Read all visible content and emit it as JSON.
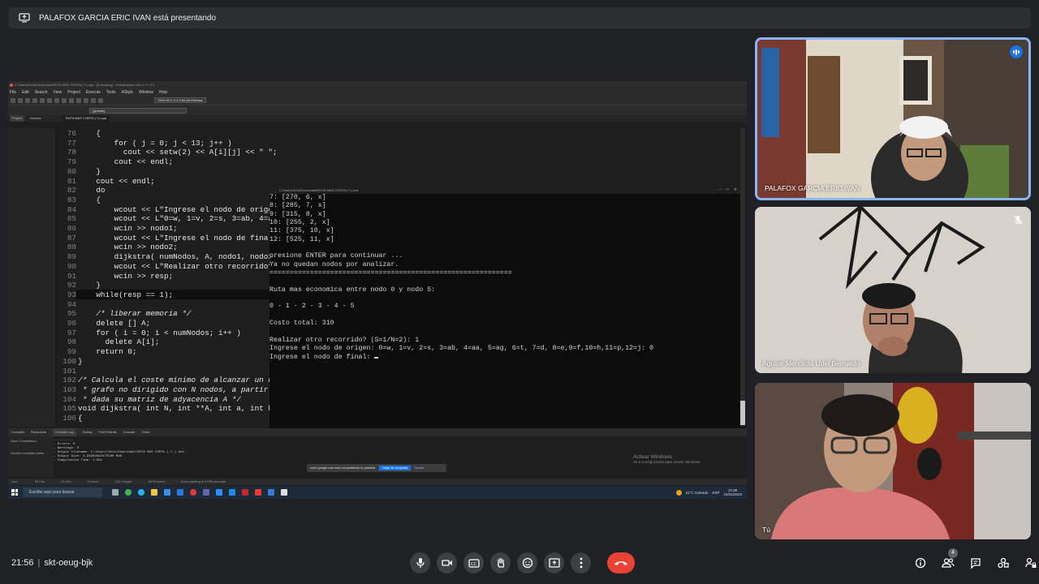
{
  "banner": {
    "text": "PALAFOX GARCIA ERIC IVAN está presentando"
  },
  "ide": {
    "title": "C:\\Users\\3c1s\\Downloads\\RUTA MAS CORTA (.Y.).cpp - [Executing] - Embarcadero Dev-C++ 6.3",
    "menu": [
      "File",
      "Edit",
      "Search",
      "View",
      "Project",
      "Execute",
      "Tools",
      "AStyle",
      "Window",
      "Help"
    ],
    "compiler": "TDM-GCC 9.2.0 64-bit Release",
    "globals": "(globals)",
    "pane_tabs": [
      "Project",
      "Classes"
    ],
    "file_tab": "RUTA MAS CORTA (.Y.).cpp",
    "code_lines": [
      {
        "n": "76",
        "t": "    {"
      },
      {
        "n": "77",
        "t": "        for ( j = 0; j < 13; j++ )"
      },
      {
        "n": "78",
        "t": "          cout << setw(2) << A[i][j] << \" \";"
      },
      {
        "n": "79",
        "t": "        cout << endl;"
      },
      {
        "n": "80",
        "t": "    }"
      },
      {
        "n": "81",
        "t": "    cout << endl;"
      },
      {
        "n": "82",
        "t": "    do"
      },
      {
        "n": "83",
        "t": "    {"
      },
      {
        "n": "84",
        "t": "        wcout << L\"Ingrese el nodo de origen"
      },
      {
        "n": "85",
        "t": "        wcout << L\"0=w, 1=v, 2=s, 3=ab, 4=aa"
      },
      {
        "n": "86",
        "t": "        wcin >> nodo1;"
      },
      {
        "n": "87",
        "t": "        wcout << L\"Ingrese el nodo de final:"
      },
      {
        "n": "88",
        "t": "        wcin >> nodo2;"
      },
      {
        "n": "89",
        "t": "        dijkstra( numNodos, A, nodo1, nodo2"
      },
      {
        "n": "90",
        "t": "        wcout << L\"Realizar otro recorrido?"
      },
      {
        "n": "91",
        "t": "        wcin >> resp;"
      },
      {
        "n": "92",
        "t": "    }"
      },
      {
        "n": "93",
        "t": "    while(resp == 1);"
      },
      {
        "n": "94",
        "t": ""
      },
      {
        "n": "95",
        "t": "    /* liberar memoria */"
      },
      {
        "n": "96",
        "t": "    delete [] A;"
      },
      {
        "n": "97",
        "t": "    for ( i = 0; i < numNodos; i++ )"
      },
      {
        "n": "98",
        "t": "      delete A[i];"
      },
      {
        "n": "99",
        "t": "    return 0;"
      },
      {
        "n": "100",
        "t": "}"
      },
      {
        "n": "101",
        "t": ""
      },
      {
        "n": "102",
        "t": "/* Calcula el coste minimo de alcanzar un nod"
      },
      {
        "n": "103",
        "t": " * grafo no dirigido con N nodos, a partir de"
      },
      {
        "n": "104",
        "t": " * dada su matriz de adyacencia A */"
      },
      {
        "n": "105",
        "t": "void dijkstra( int N, int **A, int a, int b )"
      },
      {
        "n": "106",
        "t": "{"
      }
    ],
    "bottom_tabs": [
      "Compiler",
      "Resources",
      "Compile Log",
      "Debug",
      "Find Results",
      "Console",
      "Close"
    ],
    "log_left": [
      "Abort Compilation",
      "Shorten compiler paths"
    ],
    "log_text": "----------\n- Errors: 0\n- Warnings: 0\n- Output Filename: C:\\Users\\3c1s\\Downloads\\RUTA MAS CORTA (.Y.).exe\n- Output Size: 2,99294662475586 MiB\n- Compilation Time: 1,09s",
    "status": [
      "Line:",
      "93  Col:",
      "21  Sel:",
      "0  Lines:",
      "231  Length:",
      "6675  Insert",
      "Done parsing in 0,093 seconds"
    ],
    "activate_title": "Activar Windows",
    "activate_sub": "Ve a Configuración para activar Windows.",
    "share_text": "meet.google.com está compartiendo tu pantalla.",
    "share_stop": "Dejar de compartir",
    "share_hide": "Ocultar",
    "taskbar_search": "Escribe aquí para buscar",
    "weather": "21°C  Soleado",
    "tray_lang": "ESP",
    "tray_time": "21:56",
    "tray_date": "24/01/2023"
  },
  "console": {
    "title": "C:\\Users\\3c1s\\Downloads\\RUTA MAS CORTA (.Y.).exe",
    "lines": [
      "7: [270, 6, x]",
      "8: [285, 7, x]",
      "9: [315, 8, x]",
      "10: [255, 2, x]",
      "11: [375, 10, x]",
      "12: [525, 11, x]",
      "",
      "presione ENTER para continuar ...",
      "Ya no quedan nodos por analizar.",
      "============================================================",
      "",
      "Ruta mas economica entre nodo 0 y nodo 5:",
      "",
      "0 - 1 - 2 - 3 - 4 - 5",
      "",
      "Costo total: 310",
      "",
      "Realizar otro recorrido? (S=1/N=2): 1",
      "Ingrese el nodo de origen: 0=w, 1=v, 2=s, 3=ab, 4=aa, 5=ag, 6=t, 7=d, 8=e,9=f,10=h,11=p,12=j: 0",
      "Ingrese el nodo de final: "
    ]
  },
  "participants": [
    {
      "name": "PALAFOX GARCIA ERIC IVAN",
      "speaking": true
    },
    {
      "name": "Aguilar Mendiola Uriel Bernardo",
      "muted": true
    },
    {
      "name": "Tú"
    }
  ],
  "meeting": {
    "time": "21:56",
    "code": "skt-oeug-bjk",
    "people_count": "4",
    "accent": "#8ab4f8",
    "end_color": "#ea4335"
  }
}
